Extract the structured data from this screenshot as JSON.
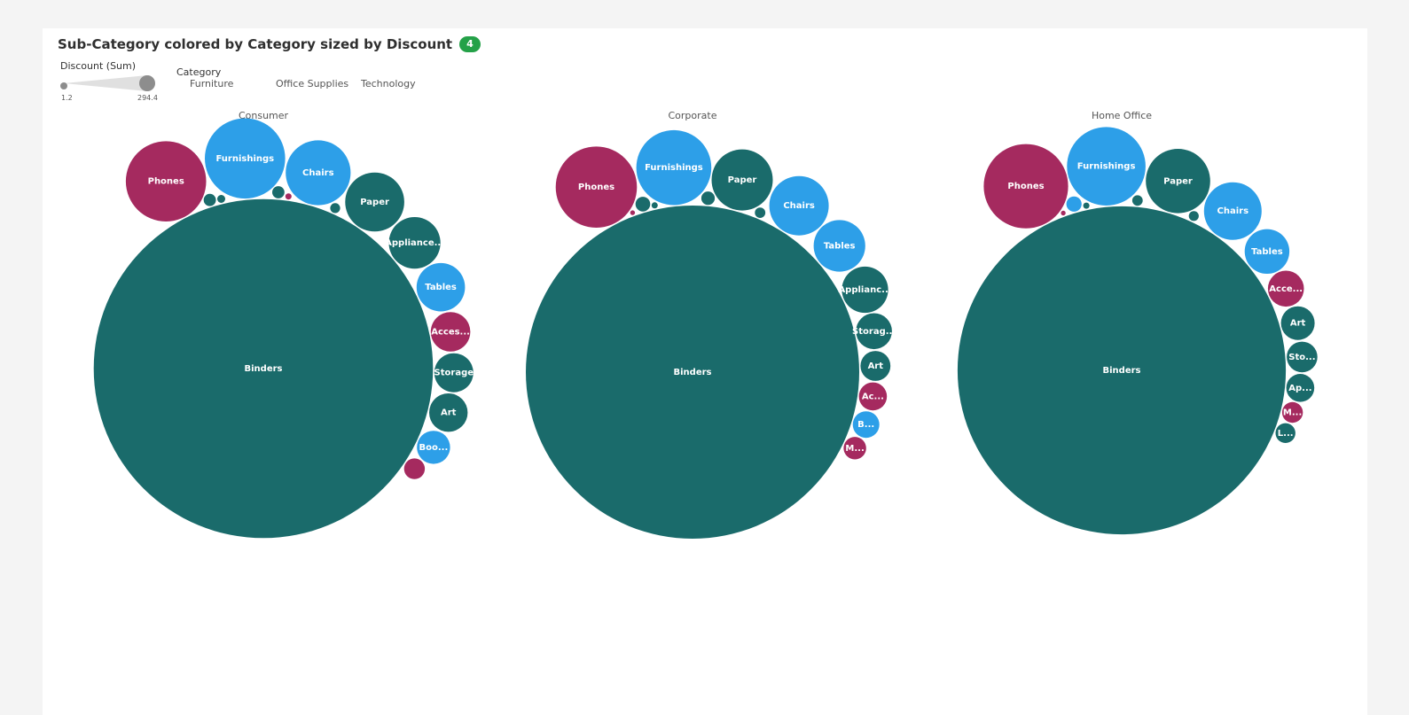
{
  "header": {
    "title": "Sub-Category colored by Category sized by Discount",
    "badge": "4"
  },
  "size_legend": {
    "title": "Discount (Sum)",
    "min_label": "1.2",
    "max_label": "294.4",
    "color": "#8d8d8d"
  },
  "category_legend": {
    "title": "Category",
    "items": [
      {
        "label": "Furniture",
        "color": "#2d9fe8"
      },
      {
        "label": "Office Supplies",
        "color": "#1a6b6b"
      },
      {
        "label": "Technology",
        "color": "#a52a5f"
      }
    ]
  },
  "chart_data": {
    "type": "bubble",
    "title": "Sub-Category colored by Category sized by Discount",
    "size_measure": "Discount (Sum)",
    "color_dimension": "Category",
    "size_range": [
      1.2,
      294.4
    ],
    "facets": [
      {
        "name": "Consumer",
        "bubbles": [
          {
            "label": "Binders",
            "category": "Office Supplies",
            "value": 294.4
          },
          {
            "label": "Phones",
            "category": "Technology",
            "value": 16.5
          },
          {
            "label": "Furnishings",
            "category": "Furniture",
            "value": 16.5
          },
          {
            "label": "Chairs",
            "category": "Furniture",
            "value": 10.8
          },
          {
            "label": "Paper",
            "category": "Office Supplies",
            "value": 8.9
          },
          {
            "label": "Tables",
            "category": "Furniture",
            "value": 6.0
          },
          {
            "label": "Appliance...",
            "category": "Office Supplies",
            "value": 6.8
          },
          {
            "label": "Acces...",
            "category": "Technology",
            "value": 4.0
          },
          {
            "label": "Storage",
            "category": "Office Supplies",
            "value": 3.9
          },
          {
            "label": "Art",
            "category": "Office Supplies",
            "value": 3.8
          },
          {
            "label": "Boo...",
            "category": "Furniture",
            "value": 2.8
          },
          {
            "label": "",
            "category": "Technology",
            "value": 1.1
          },
          {
            "label": "",
            "category": "Office Supplies",
            "value": 0.38
          },
          {
            "label": "",
            "category": "Office Supplies",
            "value": 0.38
          },
          {
            "label": "",
            "category": "Office Supplies",
            "value": 0.25
          },
          {
            "label": "",
            "category": "Office Supplies",
            "value": 0.16
          },
          {
            "label": "",
            "category": "Technology",
            "value": 0.1
          }
        ]
      },
      {
        "name": "Corporate",
        "bubbles": [
          {
            "label": "Binders",
            "category": "Office Supplies",
            "value": 284.2
          },
          {
            "label": "Phones",
            "category": "Technology",
            "value": 16.9
          },
          {
            "label": "Furnishings",
            "category": "Furniture",
            "value": 14.4
          },
          {
            "label": "Chairs",
            "category": "Furniture",
            "value": 9.0
          },
          {
            "label": "Paper",
            "category": "Office Supplies",
            "value": 9.6
          },
          {
            "label": "Tables",
            "category": "Furniture",
            "value": 6.8
          },
          {
            "label": "Applianc...",
            "category": "Office Supplies",
            "value": 5.5
          },
          {
            "label": "Storag...",
            "category": "Office Supplies",
            "value": 3.3
          },
          {
            "label": "Art",
            "category": "Office Supplies",
            "value": 2.3
          },
          {
            "label": "Ac...",
            "category": "Technology",
            "value": 2.0
          },
          {
            "label": "B...",
            "category": "Furniture",
            "value": 1.8
          },
          {
            "label": "M...",
            "category": "Technology",
            "value": 1.3
          },
          {
            "label": "",
            "category": "Office Supplies",
            "value": 0.55
          },
          {
            "label": "",
            "category": "Office Supplies",
            "value": 0.47
          },
          {
            "label": "",
            "category": "Office Supplies",
            "value": 0.28
          },
          {
            "label": "",
            "category": "Office Supplies",
            "value": 0.1
          },
          {
            "label": "",
            "category": "Technology",
            "value": 0.06
          }
        ]
      },
      {
        "name": "Home Office",
        "bubbles": [
          {
            "label": "Binders",
            "category": "Office Supplies",
            "value": 275.7
          },
          {
            "label": "Phones",
            "category": "Technology",
            "value": 18.2
          },
          {
            "label": "Furnishings",
            "category": "Furniture",
            "value": 15.8
          },
          {
            "label": "Chairs",
            "category": "Furniture",
            "value": 8.5
          },
          {
            "label": "Paper",
            "category": "Office Supplies",
            "value": 10.6
          },
          {
            "label": "Tables",
            "category": "Furniture",
            "value": 5.1
          },
          {
            "label": "Acce...",
            "category": "Technology",
            "value": 3.3
          },
          {
            "label": "Art",
            "category": "Office Supplies",
            "value": 2.9
          },
          {
            "label": "Sto...",
            "category": "Office Supplies",
            "value": 2.4
          },
          {
            "label": "Ap...",
            "category": "Office Supplies",
            "value": 2.0
          },
          {
            "label": "M...",
            "category": "Technology",
            "value": 1.1
          },
          {
            "label": "L...",
            "category": "Office Supplies",
            "value": 1.0
          },
          {
            "label": "",
            "category": "Furniture",
            "value": 0.6
          },
          {
            "label": "",
            "category": "Office Supplies",
            "value": 0.28
          },
          {
            "label": "",
            "category": "Office Supplies",
            "value": 0.25
          },
          {
            "label": "",
            "category": "Office Supplies",
            "value": 0.1
          },
          {
            "label": "",
            "category": "Technology",
            "value": 0.06
          }
        ]
      }
    ]
  }
}
